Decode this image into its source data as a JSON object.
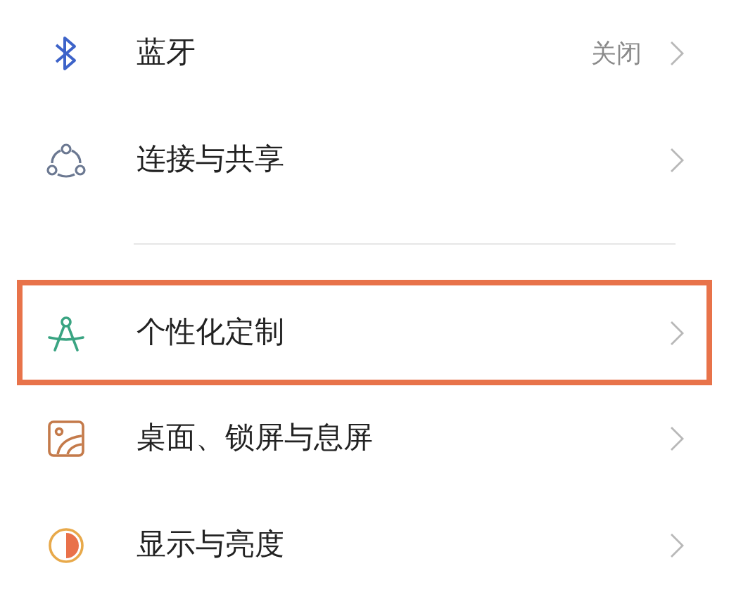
{
  "groups": [
    {
      "items": [
        {
          "kind": "bluetooth",
          "label": "蓝牙",
          "value": "关闭",
          "highlighted": false
        },
        {
          "kind": "share",
          "label": "连接与共享",
          "highlighted": false
        }
      ]
    },
    {
      "items": [
        {
          "kind": "compass",
          "label": "个性化定制",
          "highlighted": true
        },
        {
          "kind": "wallpaper",
          "label": "桌面、锁屏与息屏",
          "highlighted": false
        },
        {
          "kind": "display",
          "label": "显示与亮度",
          "highlighted": false
        }
      ]
    }
  ]
}
